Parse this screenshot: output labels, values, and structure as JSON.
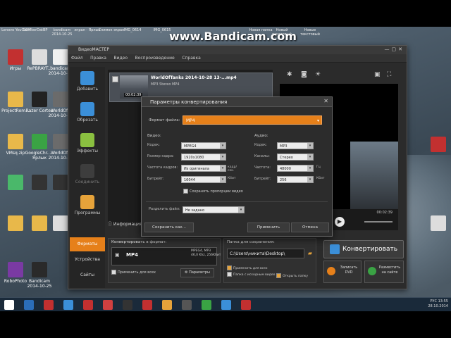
{
  "watermark": "www.Bandicam.com",
  "top_labels": [
    "Lenovo YouCam",
    "COMkerDatBP",
    "bandicam 2014-10-25",
    "играл - Ярлык",
    "Снимок экран",
    "IMG_0614",
    "IMG_0615",
    "Новая папка",
    "Новый текстовый",
    "Новые текстовый"
  ],
  "desktop_icons": [
    {
      "label": "Игры",
      "color": "#c23030"
    },
    {
      "label": "RePBRAYT...",
      "color": "#dddddd"
    },
    {
      "label": "bandicam 2014-10-20",
      "color": "#f0f0f0"
    },
    {
      "label": "ProjectRom...",
      "color": "#e8b84a"
    },
    {
      "label": "Razer Cortex",
      "color": "#222222"
    },
    {
      "label": "WorldOfT 2014-10-28",
      "color": "#6b6b6b"
    },
    {
      "label": "VMsq.zip",
      "color": "#e8b84a"
    },
    {
      "label": "GoogleChr... - Ярлык",
      "color": "#3aa344"
    },
    {
      "label": "WorldOfT 2014-10-27",
      "color": "#6b6b6b"
    },
    {
      "label": "",
      "color": "#4ab86a"
    },
    {
      "label": "",
      "color": "#333333"
    },
    {
      "label": "",
      "color": "#333333"
    },
    {
      "label": "",
      "color": "#e8b84a"
    },
    {
      "label": "",
      "color": "#e8b84a"
    },
    {
      "label": "",
      "color": "#dddddd"
    },
    {
      "label": "RoboPhoto",
      "color": "#7a3aa3"
    },
    {
      "label": "Bandicam 2014-10-25",
      "color": "#2a2a2a"
    }
  ],
  "right_icons": [
    {
      "label": "",
      "color": "#c23030"
    },
    {
      "label": "",
      "color": "#dddddd"
    }
  ],
  "app": {
    "title": "ВидеоМАСТЕР",
    "menu": [
      "Файл",
      "Правка",
      "Видео",
      "Воспроизведение",
      "Справка"
    ],
    "tools": [
      {
        "label": "Добавить",
        "color": "#3b8fd8"
      },
      {
        "label": "Обрезать",
        "color": "#3b8fd8"
      },
      {
        "label": "Эффекты",
        "color": "#8ac040"
      },
      {
        "label": "Соединить",
        "color": "#555555"
      },
      {
        "label": "Программы",
        "color": "#e6a33a"
      }
    ],
    "file": {
      "name": "WorldOfTanks 2014-10-28 13-...mp4",
      "sub": "MP3 Stereo  MP4",
      "duration": "00:02:39"
    },
    "info_button": "Информация",
    "preview_time": "00:02:39",
    "bottom_tabs": [
      "Форматы",
      "Устройства",
      "Сайты"
    ],
    "convert_section": {
      "header": "Конвертировать в формат:",
      "format": "MP4",
      "info": "MPEG4, MP3\n46,0 Khz, 256Kбит",
      "apply_all": "Применить для всех",
      "params_button": "Параметры"
    },
    "save_section": {
      "header": "Папка для сохранения:",
      "path": "C:\\Users\\никита\\Desktop\\",
      "apply_all": "Применить для всех",
      "source_folder": "Папка с исходным видео",
      "open_folder": "Открыть папку"
    },
    "convert_button": "Конвертировать",
    "dvd_button": "Записать DVD",
    "web_button": "Разместить на сайте"
  },
  "dialog": {
    "title": "Параметры конвертирования",
    "format_label": "Формат файла:",
    "format_value": "MP4",
    "video_header": "Видео:",
    "audio_header": "Аудио:",
    "video_rows": [
      {
        "label": "Кодек:",
        "value": "MPEG4",
        "unit": ""
      },
      {
        "label": "Размер кадра:",
        "value": "1920x1080",
        "unit": ""
      },
      {
        "label": "Частота кадров:",
        "value": "Из оригинала",
        "unit": "кадр/сек."
      },
      {
        "label": "Битрейт:",
        "value": "16044",
        "unit": "Кбит"
      }
    ],
    "audio_rows": [
      {
        "label": "Кодек:",
        "value": "MP3",
        "unit": ""
      },
      {
        "label": "Каналы:",
        "value": "Стерео",
        "unit": ""
      },
      {
        "label": "Частота:",
        "value": "48000",
        "unit": "Гц"
      },
      {
        "label": "Битрейт:",
        "value": "256",
        "unit": "Кбит"
      }
    ],
    "keep_proportions": "Сохранять пропорции видео",
    "split_label": "Разделить файл:",
    "split_value": "Не задано",
    "save_as": "Сохранить как...",
    "apply": "Применить",
    "cancel": "Отмена"
  },
  "taskbar": {
    "icons": [
      "#ffffff",
      "#2b6db8",
      "#c23030",
      "#3b8fd8",
      "#c23030",
      "#d04040",
      "#333333",
      "#c23030",
      "#e6a33a",
      "#555555",
      "#3aa344",
      "#3b8fd8",
      "#c23030"
    ],
    "clock": "13:55",
    "date": "28.10.2014",
    "lang": "РУС"
  }
}
